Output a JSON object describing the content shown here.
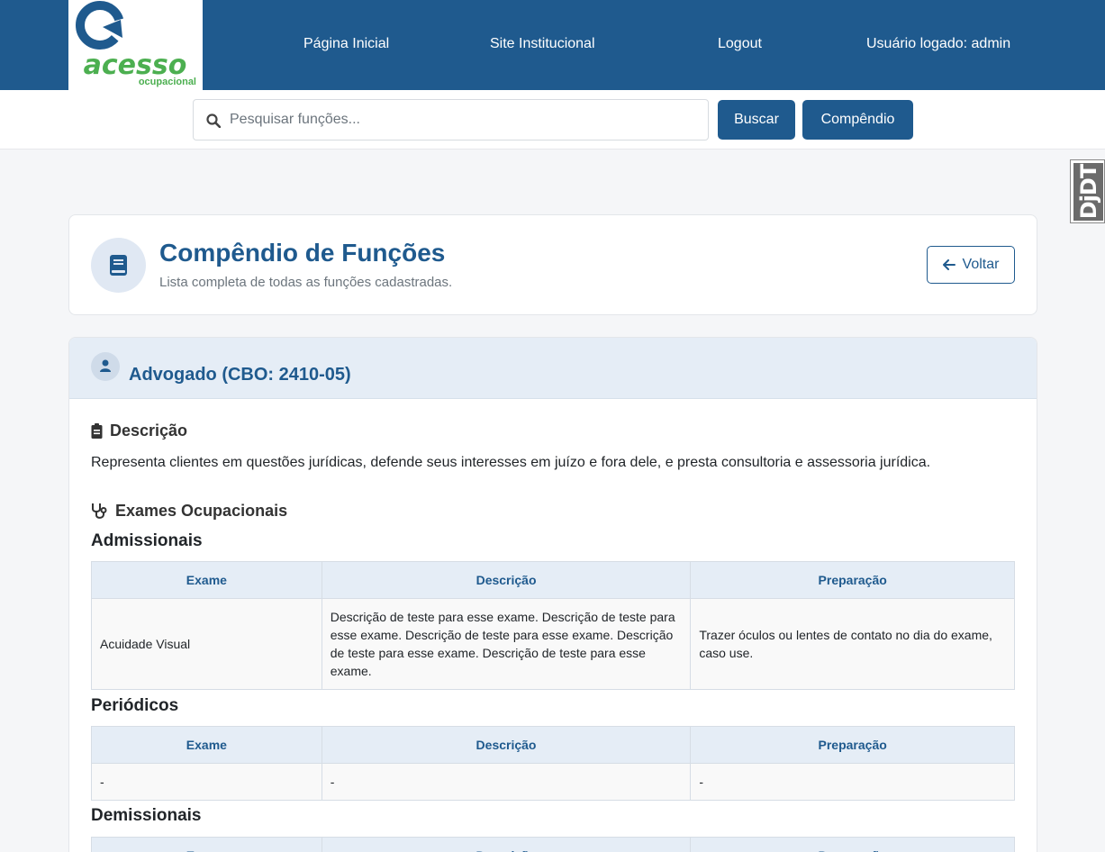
{
  "header": {
    "logo_text": "acesso",
    "logo_subtext": "ocupacional",
    "nav": [
      "Página Inicial",
      "Site Institucional",
      "Logout"
    ],
    "user": "Usuário logado: admin"
  },
  "search": {
    "placeholder": "Pesquisar funções...",
    "value": "",
    "button": "Buscar",
    "compendio_button": "Compêndio"
  },
  "side_badge": {
    "text": "DjDT"
  },
  "page": {
    "title": "Compêndio de Funções",
    "subtitle": "Lista completa de todas as funções cadastradas.",
    "back_label": "Voltar"
  },
  "funcao": {
    "title": "Advogado (CBO: 2410-05)",
    "descricao_heading": "Descrição",
    "descricao": "Representa clientes em questões jurídicas, defende seus interesses em juízo e fora dele, e presta consultoria e assessoria jurídica.",
    "exames_heading": "Exames Ocupacionais",
    "columns": [
      "Exame",
      "Descrição",
      "Preparação"
    ],
    "groups": [
      {
        "name": "Admissionais",
        "rows": [
          [
            "Acuidade Visual",
            "Descrição de teste para esse exame. Descrição de teste para esse exame. Descrição de teste para esse exame. Descrição de teste para esse exame. Descrição de teste para esse exame.",
            "Trazer óculos ou lentes de contato no dia do exame, caso use."
          ]
        ]
      },
      {
        "name": "Periódicos",
        "rows": [
          [
            "-",
            "-",
            "-"
          ]
        ]
      },
      {
        "name": "Demissionais",
        "rows": []
      }
    ]
  },
  "colors": {
    "primary": "#1f5a8e",
    "logo_green": "#4caf50",
    "header_tint": "#e5edf6"
  }
}
